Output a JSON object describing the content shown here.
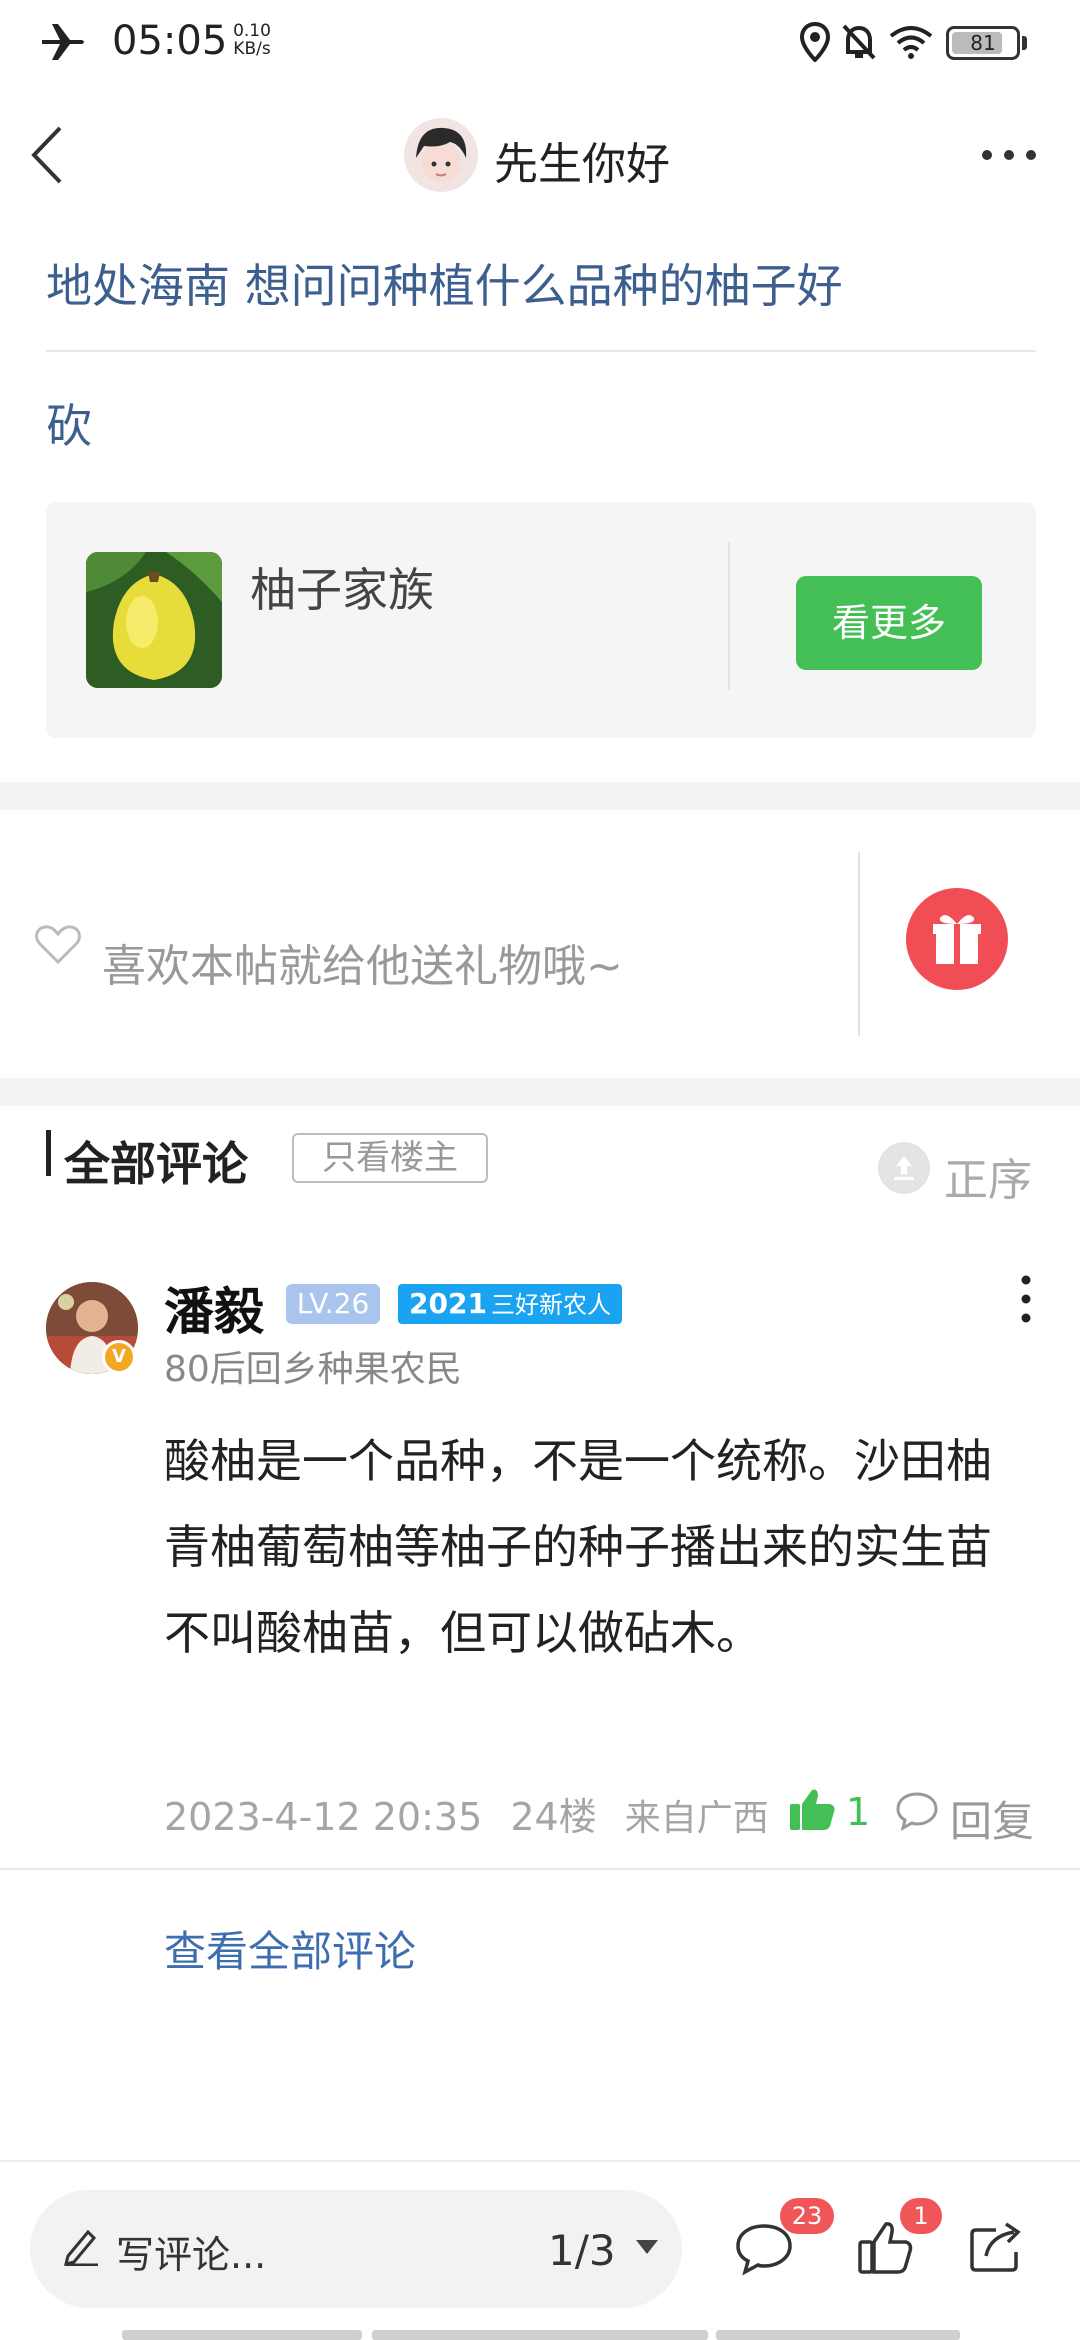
{
  "status_bar": {
    "time": "05:05",
    "speed_value": "0.10",
    "speed_unit": "KB/s",
    "battery": "81",
    "battery_level": 0.81,
    "icons": [
      "airplane-icon",
      "location-icon",
      "bell-off-icon",
      "wifi-icon",
      "battery-icon"
    ]
  },
  "header": {
    "back_icon": "chevron-left-icon",
    "username": "先生你好",
    "more_icon": "more-horizontal-icon"
  },
  "post": {
    "title": "地处海南 想问问种植什么品种的柚子好",
    "body": "砍"
  },
  "forum_card": {
    "name": "柚子家族",
    "button_label": "看更多"
  },
  "gift": {
    "prompt": "喜欢本帖就给他送礼物哦~",
    "heart_icon": "heart-outline-icon",
    "gift_icon": "gift-icon"
  },
  "comments": {
    "title": "全部评论",
    "only_owner": "只看楼主",
    "sort_label": "正序",
    "items": [
      {
        "name": "潘毅",
        "level": "LV.26",
        "honor_year": "2021",
        "honor_title": "三好新农人",
        "description": "80后回乡种果农民",
        "verified": "V",
        "text": "酸柚是一个品种，不是一个统称。沙田柚青柚葡萄柚等柚子的种子播出来的实生苗不叫酸柚苗，但可以做砧木。",
        "date": "2023-4-12 20:35",
        "floor": "24楼",
        "from": "来自广西",
        "likes": "1",
        "reply_label": "回复"
      }
    ],
    "view_all": "查看全部评论"
  },
  "bottom_bar": {
    "write_placeholder": "写评论...",
    "page": "1/3",
    "comment_count": "23",
    "like_count": "1"
  },
  "colors": {
    "link_blue": "#3d5f8f",
    "accent_green": "#43bf55",
    "gift_red": "#f04d55",
    "badge_red": "#f05658",
    "honor_blue": "#1aa3f0"
  }
}
